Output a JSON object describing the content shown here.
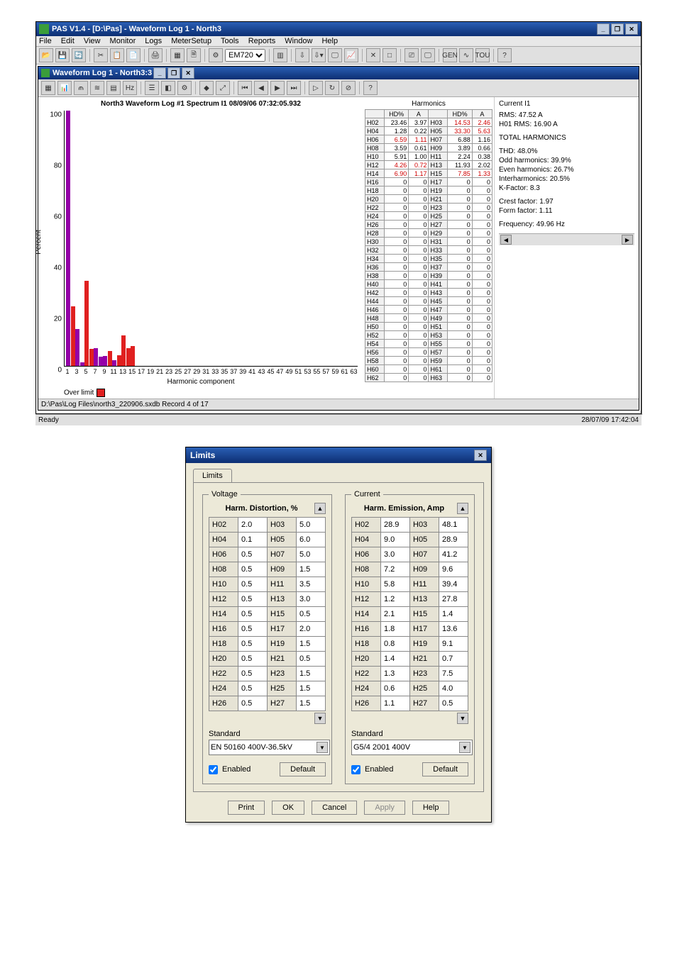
{
  "app_title": "PAS V1.4 - [D:\\Pas] - Waveform Log 1 - North3",
  "menus": [
    "File",
    "Edit",
    "View",
    "Monitor",
    "Logs",
    "MeterSetup",
    "Tools",
    "Reports",
    "Window",
    "Help"
  ],
  "device_select": "EM720",
  "subwindow_title": "Waveform Log 1 - North3:3",
  "chart": {
    "title": "North3 Waveform Log #1 Spectrum I1  08/09/06  07:32:05.932",
    "ylabel": "Percent",
    "xlabel": "Harmonic component",
    "overlimit_label": "Over limit"
  },
  "harmonics_title": "Harmonics",
  "harm_head": [
    "",
    "HD%",
    "A",
    "",
    "HD%",
    "A"
  ],
  "harm_rows": [
    [
      "H02",
      "23.46",
      "3.97",
      "H03",
      "14.53",
      "2.46",
      false,
      true
    ],
    [
      "H04",
      "1.28",
      "0.22",
      "H05",
      "33.30",
      "5.63",
      false,
      true
    ],
    [
      "H06",
      "6.59",
      "1.11",
      "H07",
      "6.88",
      "1.16",
      true,
      false
    ],
    [
      "H08",
      "3.59",
      "0.61",
      "H09",
      "3.89",
      "0.66",
      false,
      false
    ],
    [
      "H10",
      "5.91",
      "1.00",
      "H11",
      "2.24",
      "0.38",
      false,
      false
    ],
    [
      "H12",
      "4.26",
      "0.72",
      "H13",
      "11.93",
      "2.02",
      true,
      false
    ],
    [
      "H14",
      "6.90",
      "1.17",
      "H15",
      "7.85",
      "1.33",
      true,
      true
    ],
    [
      "H16",
      "0",
      "0",
      "H17",
      "0",
      "0",
      false,
      false
    ],
    [
      "H18",
      "0",
      "0",
      "H19",
      "0",
      "0",
      false,
      false
    ],
    [
      "H20",
      "0",
      "0",
      "H21",
      "0",
      "0",
      false,
      false
    ],
    [
      "H22",
      "0",
      "0",
      "H23",
      "0",
      "0",
      false,
      false
    ],
    [
      "H24",
      "0",
      "0",
      "H25",
      "0",
      "0",
      false,
      false
    ],
    [
      "H26",
      "0",
      "0",
      "H27",
      "0",
      "0",
      false,
      false
    ],
    [
      "H28",
      "0",
      "0",
      "H29",
      "0",
      "0",
      false,
      false
    ],
    [
      "H30",
      "0",
      "0",
      "H31",
      "0",
      "0",
      false,
      false
    ],
    [
      "H32",
      "0",
      "0",
      "H33",
      "0",
      "0",
      false,
      false
    ],
    [
      "H34",
      "0",
      "0",
      "H35",
      "0",
      "0",
      false,
      false
    ],
    [
      "H36",
      "0",
      "0",
      "H37",
      "0",
      "0",
      false,
      false
    ],
    [
      "H38",
      "0",
      "0",
      "H39",
      "0",
      "0",
      false,
      false
    ],
    [
      "H40",
      "0",
      "0",
      "H41",
      "0",
      "0",
      false,
      false
    ],
    [
      "H42",
      "0",
      "0",
      "H43",
      "0",
      "0",
      false,
      false
    ],
    [
      "H44",
      "0",
      "0",
      "H45",
      "0",
      "0",
      false,
      false
    ],
    [
      "H46",
      "0",
      "0",
      "H47",
      "0",
      "0",
      false,
      false
    ],
    [
      "H48",
      "0",
      "0",
      "H49",
      "0",
      "0",
      false,
      false
    ],
    [
      "H50",
      "0",
      "0",
      "H51",
      "0",
      "0",
      false,
      false
    ],
    [
      "H52",
      "0",
      "0",
      "H53",
      "0",
      "0",
      false,
      false
    ],
    [
      "H54",
      "0",
      "0",
      "H55",
      "0",
      "0",
      false,
      false
    ],
    [
      "H56",
      "0",
      "0",
      "H57",
      "0",
      "0",
      false,
      false
    ],
    [
      "H58",
      "0",
      "0",
      "H59",
      "0",
      "0",
      false,
      false
    ],
    [
      "H60",
      "0",
      "0",
      "H61",
      "0",
      "0",
      false,
      false
    ],
    [
      "H62",
      "0",
      "0",
      "H63",
      "0",
      "0",
      false,
      false
    ]
  ],
  "info": {
    "title": "Current I1",
    "rms": "RMS: 47.52 A",
    "h01": "H01 RMS: 16.90 A",
    "tot_head": "TOTAL HARMONICS",
    "thd": "THD: 48.0%",
    "odd": "Odd harmonics: 39.9%",
    "even": "Even harmonics: 26.7%",
    "inter": "Interharmonics: 20.5%",
    "kf": "K-Factor: 8.3",
    "cf": "Crest factor: 1.97",
    "ff": "Form factor: 1.11",
    "freq": "Frequency: 49.96 Hz"
  },
  "status_path": "D:\\Pas\\Log Files\\north3_220906.sxdb  Record 4 of 17",
  "ready": "Ready",
  "clock": "28/07/09 17:42:04",
  "dialog": {
    "title": "Limits",
    "tab": "Limits",
    "voltage": {
      "legend": "Voltage",
      "header": "Harm. Distortion, %",
      "rows": [
        [
          "H02",
          "2.0",
          "H03",
          "5.0"
        ],
        [
          "H04",
          "0.1",
          "H05",
          "6.0"
        ],
        [
          "H06",
          "0.5",
          "H07",
          "5.0"
        ],
        [
          "H08",
          "0.5",
          "H09",
          "1.5"
        ],
        [
          "H10",
          "0.5",
          "H11",
          "3.5"
        ],
        [
          "H12",
          "0.5",
          "H13",
          "3.0"
        ],
        [
          "H14",
          "0.5",
          "H15",
          "0.5"
        ],
        [
          "H16",
          "0.5",
          "H17",
          "2.0"
        ],
        [
          "H18",
          "0.5",
          "H19",
          "1.5"
        ],
        [
          "H20",
          "0.5",
          "H21",
          "0.5"
        ],
        [
          "H22",
          "0.5",
          "H23",
          "1.5"
        ],
        [
          "H24",
          "0.5",
          "H25",
          "1.5"
        ],
        [
          "H26",
          "0.5",
          "H27",
          "1.5"
        ]
      ],
      "std_label": "Standard",
      "std_value": "EN 50160 400V-36.5kV",
      "enabled": "Enabled",
      "default": "Default"
    },
    "current": {
      "legend": "Current",
      "header": "Harm. Emission, Amp",
      "rows": [
        [
          "H02",
          "28.9",
          "H03",
          "48.1"
        ],
        [
          "H04",
          "9.0",
          "H05",
          "28.9"
        ],
        [
          "H06",
          "3.0",
          "H07",
          "41.2"
        ],
        [
          "H08",
          "7.2",
          "H09",
          "9.6"
        ],
        [
          "H10",
          "5.8",
          "H11",
          "39.4"
        ],
        [
          "H12",
          "1.2",
          "H13",
          "27.8"
        ],
        [
          "H14",
          "2.1",
          "H15",
          "1.4"
        ],
        [
          "H16",
          "1.8",
          "H17",
          "13.6"
        ],
        [
          "H18",
          "0.8",
          "H19",
          "9.1"
        ],
        [
          "H20",
          "1.4",
          "H21",
          "0.7"
        ],
        [
          "H22",
          "1.3",
          "H23",
          "7.5"
        ],
        [
          "H24",
          "0.6",
          "H25",
          "4.0"
        ],
        [
          "H26",
          "1.1",
          "H27",
          "0.5"
        ]
      ],
      "std_label": "Standard",
      "std_value": "G5/4 2001 400V",
      "enabled": "Enabled",
      "default": "Default"
    },
    "buttons": {
      "print": "Print",
      "ok": "OK",
      "cancel": "Cancel",
      "apply": "Apply",
      "help": "Help"
    }
  },
  "chart_data": {
    "type": "bar",
    "title": "North3 Waveform Log #1 Spectrum I1  08/09/06  07:32:05.932",
    "xlabel": "Harmonic component",
    "ylabel": "Percent",
    "ylim": [
      0,
      100
    ],
    "categories": [
      1,
      2,
      3,
      4,
      5,
      6,
      7,
      8,
      9,
      10,
      11,
      12,
      13,
      14,
      15,
      16,
      17,
      18,
      19,
      20,
      21,
      22,
      23,
      24,
      25,
      26,
      27,
      28,
      29,
      30,
      31,
      32,
      33,
      34,
      35,
      36,
      37,
      38,
      39,
      40,
      41,
      42,
      43,
      44,
      45,
      46,
      47,
      48,
      49,
      50,
      51,
      52,
      53,
      54,
      55,
      56,
      57,
      58,
      59,
      60,
      61,
      62,
      63
    ],
    "values": [
      100,
      23.46,
      14.53,
      1.28,
      33.3,
      6.59,
      6.88,
      3.59,
      3.89,
      5.91,
      2.24,
      4.26,
      11.93,
      6.9,
      7.85,
      0,
      0,
      0,
      0,
      0,
      0,
      0,
      0,
      0,
      0,
      0,
      0,
      0,
      0,
      0,
      0,
      0,
      0,
      0,
      0,
      0,
      0,
      0,
      0,
      0,
      0,
      0,
      0,
      0,
      0,
      0,
      0,
      0,
      0,
      0,
      0,
      0,
      0,
      0,
      0,
      0,
      0,
      0,
      0,
      0,
      0,
      0,
      0
    ],
    "over_limit_indices": [
      2,
      5,
      6,
      10,
      12,
      13,
      14,
      15
    ]
  }
}
